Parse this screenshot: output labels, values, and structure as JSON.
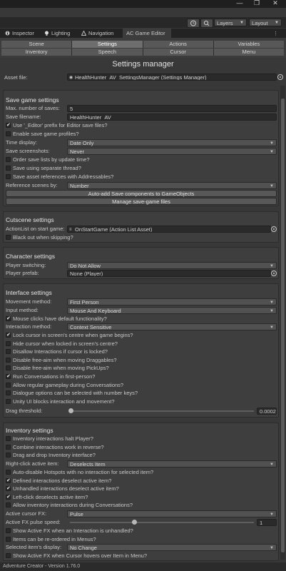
{
  "window": {
    "controls": [
      "—",
      "❐",
      "✕"
    ]
  },
  "toolbar_top": {
    "layers_label": "Layers",
    "layout_label": "Layout"
  },
  "tabs": [
    {
      "label": "Inspector",
      "icon": "info-icon"
    },
    {
      "label": "Lighting",
      "icon": "bulb-icon"
    },
    {
      "label": "Navigation",
      "icon": "navigation-icon"
    },
    {
      "label": "AC Game Editor",
      "icon": null,
      "active": true
    }
  ],
  "editor_tabs": [
    [
      "Scene",
      "Settings",
      "Actions",
      "Variables"
    ],
    [
      "Inventory",
      "Speech",
      "Cursor",
      "Menu"
    ]
  ],
  "active_editor_tab": "Settings",
  "page_title": "Settings manager",
  "asset_file": {
    "label": "Asset file:",
    "value": "HealthHunter_AV_SettingsManager (Settings Manager)"
  },
  "save_game": {
    "title": "Save game settings",
    "max_saves": {
      "label": "Max. number of saves:",
      "value": "5"
    },
    "save_filename": {
      "label": "Save filename:",
      "value": "HealthHunter_AV"
    },
    "use_editor_prefix": {
      "label": "Use '_Editor' prefix for Editor save files?",
      "checked": true
    },
    "enable_profiles": {
      "label": "Enable save game profiles?",
      "checked": false
    },
    "time_display": {
      "label": "Time display:",
      "value": "Date Only"
    },
    "save_screenshots": {
      "label": "Save screenshots:",
      "value": "Never"
    },
    "order_by_time": {
      "label": "Order save lists by update time?",
      "checked": false
    },
    "separate_thread": {
      "label": "Save using separate thread?",
      "checked": false
    },
    "addressables": {
      "label": "Save asset references with Addressables?",
      "checked": false
    },
    "reference_scenes": {
      "label": "Reference scenes by:",
      "value": "Number"
    },
    "auto_add_button": "Auto-add Save components to GameObjects",
    "manage_button": "Manage save-game files"
  },
  "cutscene": {
    "title": "Cutscene settings",
    "actionlist_start": {
      "label": "ActionList on start game:",
      "value": "OnStartGame (Action List Asset)"
    },
    "black_out": {
      "label": "Black out when skipping?",
      "checked": false
    }
  },
  "character": {
    "title": "Character settings",
    "player_switching": {
      "label": "Player switching:",
      "value": "Do Not Allow"
    },
    "player_prefab": {
      "label": "Player prefab:",
      "value": "None (Player)"
    }
  },
  "interface": {
    "title": "Interface settings",
    "movement_method": {
      "label": "Movement method:",
      "value": "First Person"
    },
    "input_method": {
      "label": "Input method:",
      "value": "Mouse And Keyboard"
    },
    "mouse_clicks_default": {
      "label": "Mouse clicks have default functionality?",
      "checked": true
    },
    "interaction_method": {
      "label": "Interaction method:",
      "value": "Context Sensitive"
    },
    "checks": [
      {
        "label": "Lock cursor in screen's centre when game begins?",
        "checked": true
      },
      {
        "label": "Hide cursor when locked in screen's centre?",
        "checked": false
      },
      {
        "label": "Disallow Interactions if cursor is locked?",
        "checked": false
      },
      {
        "label": "Disable free-aim when moving Draggables?",
        "checked": false
      },
      {
        "label": "Disable free-aim when moving PickUps?",
        "checked": false
      },
      {
        "label": "Run Conversations in first-person?",
        "checked": true
      },
      {
        "label": "Allow regular gameplay during Conversations?",
        "checked": false
      },
      {
        "label": "Dialogue options can be selected with number keys?",
        "checked": false
      },
      {
        "label": "Unity UI blocks interaction and movement?",
        "checked": false
      }
    ],
    "drag_threshold": {
      "label": "Drag threshold:",
      "value": "0.0002"
    }
  },
  "inventory": {
    "title": "Inventory settings",
    "checks_a": [
      {
        "label": "Inventory interactions halt Player?",
        "checked": false
      },
      {
        "label": "Combine interactions work in reverse?",
        "checked": false
      },
      {
        "label": "Drag and drop Inventory interface?",
        "checked": false
      }
    ],
    "right_click": {
      "label": "Right-click active item:",
      "value": "Deselects Item"
    },
    "checks_b": [
      {
        "label": "Auto-disable Hotspots with no interaction for selected item?",
        "checked": false
      },
      {
        "label": "Defined interactions deselect active item?",
        "checked": true
      },
      {
        "label": "Unhandled interactions deselect active item?",
        "checked": true
      },
      {
        "label": "Left-click deselects active item?",
        "checked": true
      },
      {
        "label": "Allow inventory interactions during Conversations?",
        "checked": false
      }
    ],
    "active_cursor_fx": {
      "label": "Active cursor FX:",
      "value": "Pulse"
    },
    "pulse_speed": {
      "label": "Active FX pulse speed:",
      "value": "1",
      "level": 0.35
    },
    "checks_c": [
      {
        "label": "Show Active FX when an Interaction is unhandled?",
        "checked": false
      },
      {
        "label": "Items can be re-ordered in Menus?",
        "checked": false
      }
    ],
    "selected_display": {
      "label": "Selected item's display:",
      "value": "No Change"
    },
    "checks_d": [
      {
        "label": "Show Active FX when Cursor hovers over Item in Menu?",
        "checked": false
      }
    ]
  },
  "footer": "Adventure Creator - Version 1.76.0"
}
